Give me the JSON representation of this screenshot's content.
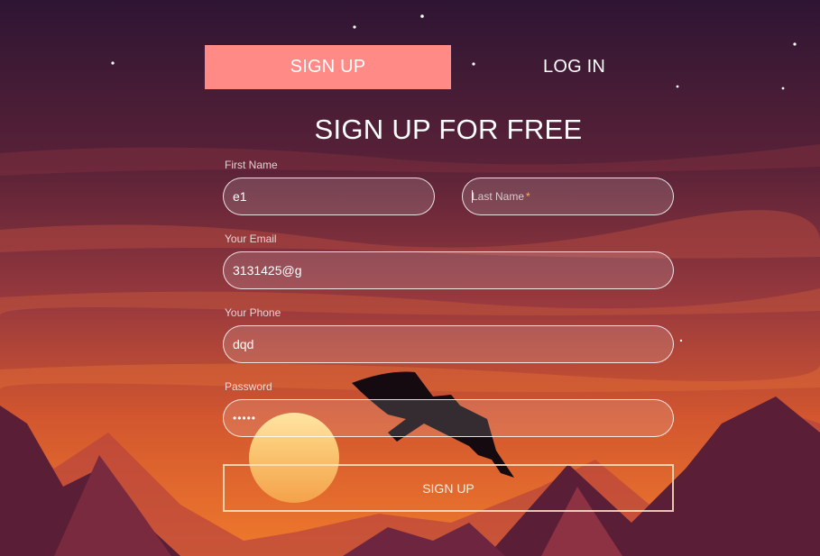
{
  "tabs": {
    "signup_label": "SIGN UP",
    "login_label": "LOG IN"
  },
  "form": {
    "title": "SIGN UP FOR FREE",
    "first_name": {
      "label": "First Name",
      "value": "e1"
    },
    "last_name": {
      "placeholder": "Last Name",
      "required_mark": "*"
    },
    "email": {
      "label": "Your Email",
      "value": "3131425@g"
    },
    "phone": {
      "label": "Your Phone",
      "value": "dqd"
    },
    "password": {
      "label": "Password",
      "value": "•••••"
    },
    "submit_label": "SIGN UP"
  },
  "colors": {
    "accent": "#ff8a86",
    "sky_top": "#2e1533",
    "sky_mid": "#8a3340",
    "sky_low": "#e0642e",
    "sun": "#ffd27a"
  }
}
